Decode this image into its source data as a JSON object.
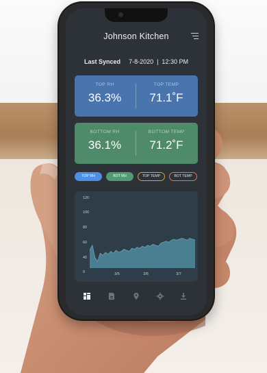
{
  "app": {
    "title": "Johnson Kitchen"
  },
  "sync": {
    "label": "Last Synced",
    "value": "7-8-2020  |  12:30 PM"
  },
  "top_card": {
    "rh_label": "TOP RH",
    "rh_value": "36.3%",
    "temp_label": "TOP TEMP",
    "temp_value": "71.1˚F"
  },
  "bottom_card": {
    "rh_label": "BOTTOM RH",
    "rh_value": "36.1%",
    "temp_label": "BOTTOM TEMP",
    "temp_value": "71.2˚F"
  },
  "filters": [
    "TOP RH",
    "BOT RH",
    "TOP TEMP",
    "BOT TEMP"
  ],
  "colors": {
    "top_card": "#4a74ad",
    "bottom_card": "#4f8a6a",
    "pill_top_rh": "#4b8fe6",
    "pill_bot_rh": "#4f9c72",
    "pill_top_temp_border": "#d9a441",
    "pill_bot_temp_border": "#d57b66",
    "area_fill": "#4a7f92"
  },
  "chart_data": {
    "type": "area",
    "y_ticks": [
      "120",
      "100",
      "80",
      "60",
      "40",
      "0"
    ],
    "x_ticks": [
      "3/5",
      "3/6",
      "3/7"
    ],
    "ylim": [
      0,
      120
    ],
    "x": [
      0,
      1,
      2,
      3,
      4,
      5,
      6,
      7,
      8,
      9,
      10,
      11,
      12,
      13,
      14,
      15,
      16,
      17,
      18,
      19,
      20,
      21,
      22,
      23,
      24,
      25,
      26,
      27,
      28,
      29,
      30,
      31,
      32,
      33,
      34,
      35,
      36,
      37,
      38,
      39,
      40
    ],
    "values": [
      55,
      60,
      48,
      44,
      52,
      50,
      53,
      51,
      54,
      52,
      55,
      53,
      54,
      56,
      55,
      54,
      57,
      56,
      58,
      57,
      59,
      58,
      60,
      59,
      61,
      60,
      59,
      62,
      63,
      64,
      63,
      65,
      66,
      65,
      66,
      67,
      66,
      65,
      67,
      66,
      65
    ]
  },
  "bottom_nav": [
    {
      "icon": "dashboard-icon",
      "active": true
    },
    {
      "icon": "document-icon",
      "active": false
    },
    {
      "icon": "location-pin-icon",
      "active": false
    },
    {
      "icon": "gear-icon",
      "active": false
    },
    {
      "icon": "download-icon",
      "active": false
    }
  ]
}
